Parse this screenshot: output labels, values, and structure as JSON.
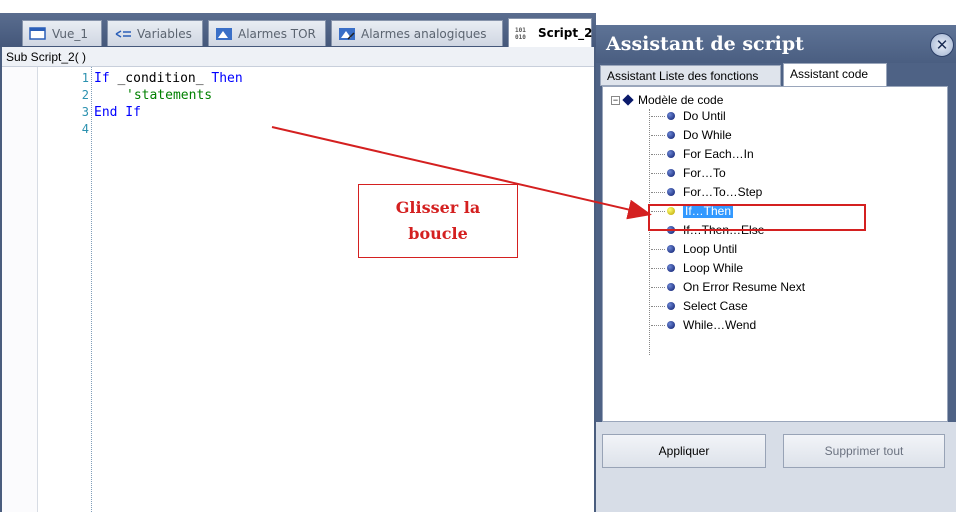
{
  "tabs": [
    {
      "label": "Vue_1",
      "icon": "screen-icon"
    },
    {
      "label": "Variables",
      "icon": "variables-icon"
    },
    {
      "label": "Alarmes TOR",
      "icon": "alarm-tor-icon"
    },
    {
      "label": "Alarmes analogiques",
      "icon": "alarm-analog-icon"
    },
    {
      "label": "Script_2",
      "icon": "script-icon"
    }
  ],
  "editor": {
    "sub_header": "Sub Script_2( )",
    "line_numbers": [
      "1",
      "2",
      "3",
      "4"
    ],
    "lines": [
      {
        "kw1": "If",
        "text": " _condition_ ",
        "kw2": "Then"
      },
      {
        "comment": "'statements"
      },
      {
        "kw1": "End If"
      }
    ]
  },
  "annotation": {
    "line1": "Glisser la",
    "line2": "boucle",
    "color": "#d42020"
  },
  "assistant": {
    "title": "Assistant de script",
    "close_label": "✕",
    "tabs": [
      "Assistant Liste des fonctions",
      "Assistant code"
    ],
    "tree_root": "Modèle de code",
    "tree_items": [
      "Do Until",
      "Do While",
      "For Each…In",
      "For…To",
      "For…To…Step",
      "If…Then",
      "If…Then…Else",
      "Loop Until",
      "Loop While",
      "On Error Resume Next",
      "Select Case",
      "While…Wend"
    ],
    "selected_item": "If…Then",
    "buttons": {
      "apply": "Appliquer",
      "clear": "Supprimer tout"
    }
  }
}
